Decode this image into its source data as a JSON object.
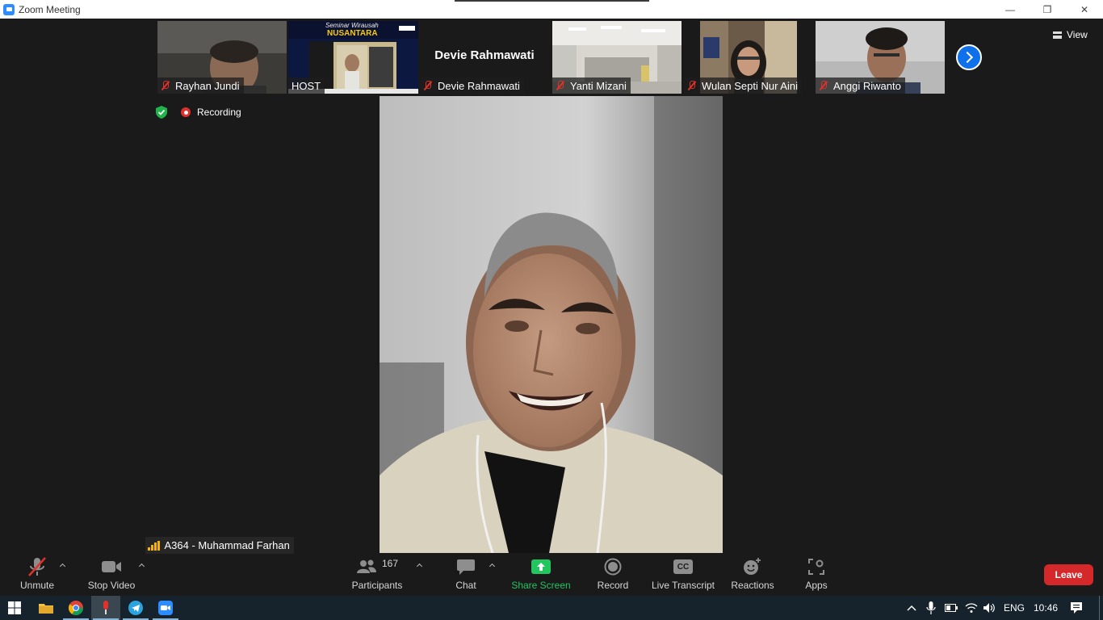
{
  "window": {
    "title": "Zoom Meeting",
    "minimize": "—",
    "restore": "❐",
    "close": "✕"
  },
  "top_bar": {
    "view_label": "View"
  },
  "participants_strip": [
    {
      "name": "Rayhan Jundi",
      "muted": true
    },
    {
      "name": "HOST",
      "muted": false,
      "banner_line1": "Seminar Wirausah",
      "banner_line2": "NUSANTARA"
    },
    {
      "name": "Devie Rahmawati",
      "muted": true,
      "video_off": true,
      "display_name": "Devie Rahmawati"
    },
    {
      "name": "Yanti Mizani",
      "muted": true
    },
    {
      "name": "Wulan Septi Nur Aini",
      "muted": true
    },
    {
      "name": "Anggi Riwanto",
      "muted": true
    }
  ],
  "indicators": {
    "recording_label": "Recording"
  },
  "active_speaker": {
    "name": "A364 - Muhammad Farhan"
  },
  "toolbar": {
    "unmute": "Unmute",
    "stop_video": "Stop Video",
    "participants_count": "167",
    "participants": "Participants",
    "chat": "Chat",
    "share_screen": "Share Screen",
    "record": "Record",
    "live_transcript": "Live Transcript",
    "cc": "CC",
    "reactions": "Reactions",
    "apps": "Apps",
    "leave": "Leave"
  },
  "taskbar": {
    "language": "ENG",
    "time": "10:46"
  },
  "colors": {
    "accent_blue": "#0e71eb",
    "leave_red": "#d5282a",
    "share_green": "#22c55e",
    "mute_red": "#e0322b"
  }
}
